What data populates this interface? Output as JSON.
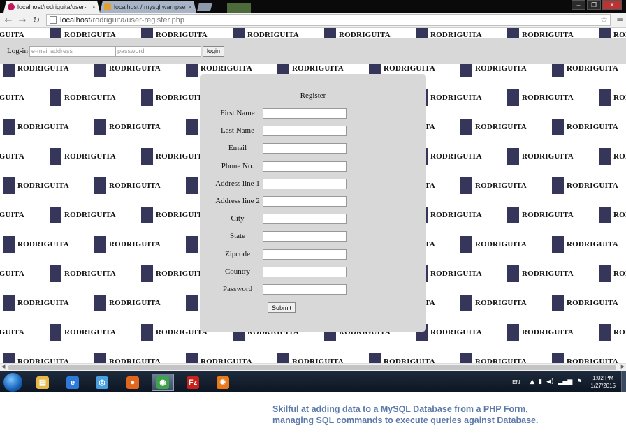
{
  "browser": {
    "tabs": [
      {
        "title": "localhost/rodriguita/user-",
        "close": "×",
        "active": true
      },
      {
        "title": "localhost / mysql wampse",
        "close": "×",
        "active": false
      }
    ],
    "url_host": "localhost",
    "url_path": "/rodriguita/user-register.php",
    "window_buttons": [
      "–",
      "❐",
      "✕"
    ]
  },
  "page": {
    "brand_text": "RODRIGUITA",
    "brand_color": "#36365a",
    "login": {
      "label": "Log-in",
      "email_placeholder": "e-mail address",
      "password_placeholder": "password",
      "button": "login"
    },
    "register": {
      "title": "Register",
      "fields": [
        {
          "label": "First Name",
          "value": ""
        },
        {
          "label": "Last Name",
          "value": ""
        },
        {
          "label": "Email",
          "value": ""
        },
        {
          "label": "Phone No.",
          "value": ""
        },
        {
          "label": "Address line 1",
          "value": ""
        },
        {
          "label": "Address line 2",
          "value": ""
        },
        {
          "label": "City",
          "value": ""
        },
        {
          "label": "State",
          "value": ""
        },
        {
          "label": "Zipcode",
          "value": ""
        },
        {
          "label": "Country",
          "value": ""
        },
        {
          "label": "Password",
          "value": ""
        }
      ],
      "submit": "Submit"
    }
  },
  "taskbar": {
    "apps": [
      {
        "name": "file-explorer-icon",
        "color": "#e8b84a"
      },
      {
        "name": "internet-explorer-icon",
        "color": "#2f7ad8"
      },
      {
        "name": "safari-icon",
        "color": "#4aa0e0"
      },
      {
        "name": "firefox-icon",
        "color": "#e2661b"
      },
      {
        "name": "chrome-icon",
        "color": "#3fa34d"
      },
      {
        "name": "filezilla-icon",
        "color": "#c8211c"
      },
      {
        "name": "wamp-icon",
        "color": "#e87a1b"
      }
    ],
    "language": "EN",
    "time": "1:02 PM",
    "date": "1/27/2015"
  },
  "caption": {
    "line1": "Skilful at adding data to a MySQL Database from a PHP Form,",
    "line2": "managing SQL commands to execute queries against Database."
  }
}
